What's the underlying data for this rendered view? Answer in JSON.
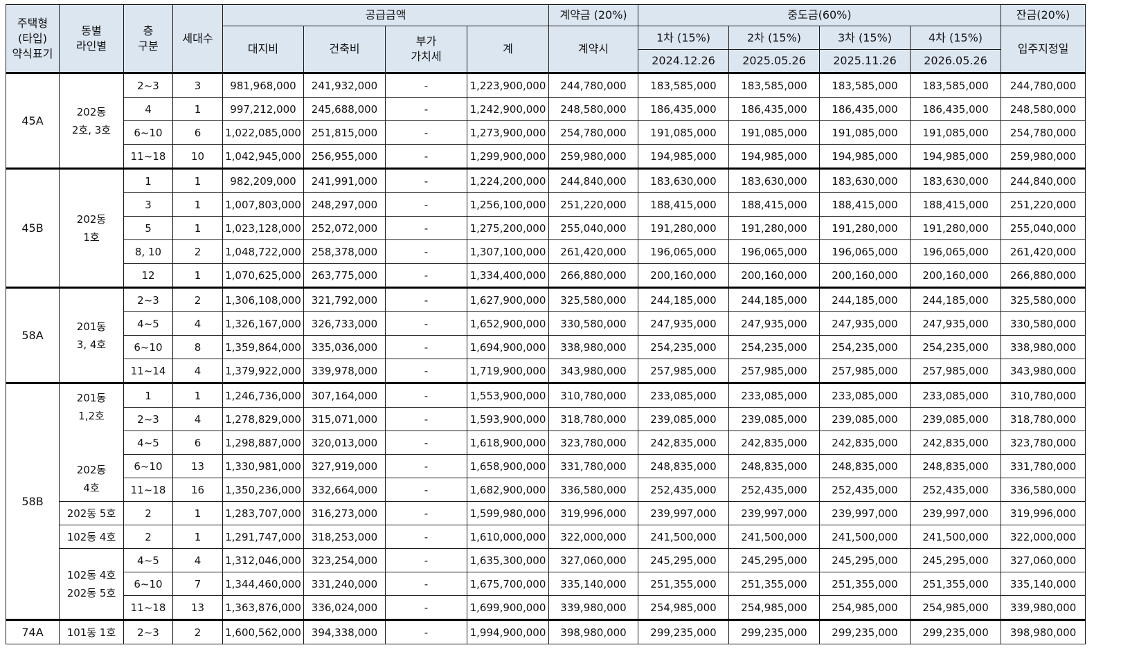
{
  "headers": {
    "type": "주택형\n(타입)\n약식표기",
    "dong": "동별\n라인별",
    "floor": "층\n구분",
    "units": "세대수",
    "supply": "공급금액",
    "land": "대지비",
    "building": "건축비",
    "vat": "부가\n가치세",
    "total": "계",
    "deposit": "계약금 (20%)",
    "deposit_sub": "계약시",
    "middle": "중도금(60%)",
    "m1": "1차 (15%)",
    "m2": "2차 (15%)",
    "m3": "3차 (15%)",
    "m4": "4차 (15%)",
    "m1_date": "2024.12.26",
    "m2_date": "2025.05.26",
    "m3_date": "2025.11.26",
    "m4_date": "2026.05.26",
    "balance": "잔금(20%)",
    "balance_sub": "입주지정일"
  },
  "groups": [
    {
      "type": "45A",
      "dongs": [
        {
          "label": "202동\n2호, 3호",
          "rows": [
            [
              "2~3",
              "3",
              "981,968,000",
              "241,932,000",
              "-",
              "1,223,900,000",
              "244,780,000",
              "183,585,000",
              "183,585,000",
              "183,585,000",
              "183,585,000",
              "244,780,000"
            ],
            [
              "4",
              "1",
              "997,212,000",
              "245,688,000",
              "-",
              "1,242,900,000",
              "248,580,000",
              "186,435,000",
              "186,435,000",
              "186,435,000",
              "186,435,000",
              "248,580,000"
            ],
            [
              "6~10",
              "6",
              "1,022,085,000",
              "251,815,000",
              "-",
              "1,273,900,000",
              "254,780,000",
              "191,085,000",
              "191,085,000",
              "191,085,000",
              "191,085,000",
              "254,780,000"
            ],
            [
              "11~18",
              "10",
              "1,042,945,000",
              "256,955,000",
              "-",
              "1,299,900,000",
              "259,980,000",
              "194,985,000",
              "194,985,000",
              "194,985,000",
              "194,985,000",
              "259,980,000"
            ]
          ]
        }
      ]
    },
    {
      "type": "45B",
      "dongs": [
        {
          "label": "202동\n1호",
          "rows": [
            [
              "1",
              "1",
              "982,209,000",
              "241,991,000",
              "-",
              "1,224,200,000",
              "244,840,000",
              "183,630,000",
              "183,630,000",
              "183,630,000",
              "183,630,000",
              "244,840,000"
            ],
            [
              "3",
              "1",
              "1,007,803,000",
              "248,297,000",
              "-",
              "1,256,100,000",
              "251,220,000",
              "188,415,000",
              "188,415,000",
              "188,415,000",
              "188,415,000",
              "251,220,000"
            ],
            [
              "5",
              "1",
              "1,023,128,000",
              "252,072,000",
              "-",
              "1,275,200,000",
              "255,040,000",
              "191,280,000",
              "191,280,000",
              "191,280,000",
              "191,280,000",
              "255,040,000"
            ],
            [
              "8, 10",
              "2",
              "1,048,722,000",
              "258,378,000",
              "-",
              "1,307,100,000",
              "261,420,000",
              "196,065,000",
              "196,065,000",
              "196,065,000",
              "196,065,000",
              "261,420,000"
            ],
            [
              "12",
              "1",
              "1,070,625,000",
              "263,775,000",
              "-",
              "1,334,400,000",
              "266,880,000",
              "200,160,000",
              "200,160,000",
              "200,160,000",
              "200,160,000",
              "266,880,000"
            ]
          ]
        }
      ]
    },
    {
      "type": "58A",
      "dongs": [
        {
          "label": "201동\n3, 4호",
          "rows": [
            [
              "2~3",
              "2",
              "1,306,108,000",
              "321,792,000",
              "-",
              "1,627,900,000",
              "325,580,000",
              "244,185,000",
              "244,185,000",
              "244,185,000",
              "244,185,000",
              "325,580,000"
            ],
            [
              "4~5",
              "4",
              "1,326,167,000",
              "326,733,000",
              "-",
              "1,652,900,000",
              "330,580,000",
              "247,935,000",
              "247,935,000",
              "247,935,000",
              "247,935,000",
              "330,580,000"
            ],
            [
              "6~10",
              "8",
              "1,359,864,000",
              "335,036,000",
              "-",
              "1,694,900,000",
              "338,980,000",
              "254,235,000",
              "254,235,000",
              "254,235,000",
              "254,235,000",
              "338,980,000"
            ],
            [
              "11~14",
              "4",
              "1,379,922,000",
              "339,978,000",
              "-",
              "1,719,900,000",
              "343,980,000",
              "257,985,000",
              "257,985,000",
              "257,985,000",
              "257,985,000",
              "343,980,000"
            ]
          ]
        }
      ]
    },
    {
      "type": "58B",
      "dongs": [
        {
          "label": "201동\n1,2호\n\n\n202동\n4호",
          "rows": [
            [
              "1",
              "1",
              "1,246,736,000",
              "307,164,000",
              "-",
              "1,553,900,000",
              "310,780,000",
              "233,085,000",
              "233,085,000",
              "233,085,000",
              "233,085,000",
              "310,780,000"
            ],
            [
              "2~3",
              "4",
              "1,278,829,000",
              "315,071,000",
              "-",
              "1,593,900,000",
              "318,780,000",
              "239,085,000",
              "239,085,000",
              "239,085,000",
              "239,085,000",
              "318,780,000"
            ],
            [
              "4~5",
              "6",
              "1,298,887,000",
              "320,013,000",
              "-",
              "1,618,900,000",
              "323,780,000",
              "242,835,000",
              "242,835,000",
              "242,835,000",
              "242,835,000",
              "323,780,000"
            ],
            [
              "6~10",
              "13",
              "1,330,981,000",
              "327,919,000",
              "-",
              "1,658,900,000",
              "331,780,000",
              "248,835,000",
              "248,835,000",
              "248,835,000",
              "248,835,000",
              "331,780,000"
            ],
            [
              "11~18",
              "16",
              "1,350,236,000",
              "332,664,000",
              "-",
              "1,682,900,000",
              "336,580,000",
              "252,435,000",
              "252,435,000",
              "252,435,000",
              "252,435,000",
              "336,580,000"
            ]
          ]
        },
        {
          "label": "202동 5호",
          "rows": [
            [
              "2",
              "1",
              "1,283,707,000",
              "316,273,000",
              "-",
              "1,599,980,000",
              "319,996,000",
              "239,997,000",
              "239,997,000",
              "239,997,000",
              "239,997,000",
              "319,996,000"
            ]
          ]
        },
        {
          "label": "102동 4호",
          "rows": [
            [
              "2",
              "1",
              "1,291,747,000",
              "318,253,000",
              "-",
              "1,610,000,000",
              "322,000,000",
              "241,500,000",
              "241,500,000",
              "241,500,000",
              "241,500,000",
              "322,000,000"
            ]
          ]
        },
        {
          "label": "102동 4호\n202동 5호",
          "rows": [
            [
              "4~5",
              "4",
              "1,312,046,000",
              "323,254,000",
              "-",
              "1,635,300,000",
              "327,060,000",
              "245,295,000",
              "245,295,000",
              "245,295,000",
              "245,295,000",
              "327,060,000"
            ],
            [
              "6~10",
              "7",
              "1,344,460,000",
              "331,240,000",
              "-",
              "1,675,700,000",
              "335,140,000",
              "251,355,000",
              "251,355,000",
              "251,355,000",
              "251,355,000",
              "335,140,000"
            ],
            [
              "11~18",
              "13",
              "1,363,876,000",
              "336,024,000",
              "-",
              "1,699,900,000",
              "339,980,000",
              "254,985,000",
              "254,985,000",
              "254,985,000",
              "254,985,000",
              "339,980,000"
            ]
          ]
        }
      ]
    },
    {
      "type": "74A",
      "dongs": [
        {
          "label": "101동 1호",
          "rows": [
            [
              "2~3",
              "2",
              "1,600,562,000",
              "394,338,000",
              "-",
              "1,994,900,000",
              "398,980,000",
              "299,235,000",
              "299,235,000",
              "299,235,000",
              "299,235,000",
              "398,980,000"
            ]
          ]
        }
      ]
    }
  ]
}
